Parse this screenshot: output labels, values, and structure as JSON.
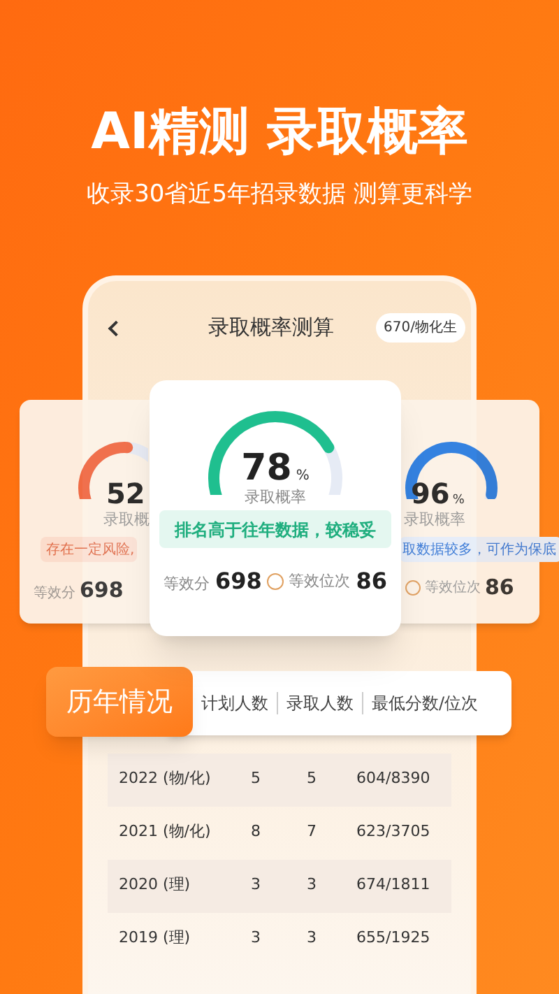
{
  "headline": "AI精测 录取概率",
  "subtitle": "收录30省近5年招录数据 测算更科学",
  "nav": {
    "title": "录取概率测算",
    "badge": "670/物化生"
  },
  "cards": [
    {
      "kind": "left",
      "percent": "52",
      "label": "录取概",
      "color": "#f06a45",
      "note": "存在一定风险,",
      "stat1_label": "等效分",
      "stat1_value": "698"
    },
    {
      "kind": "center",
      "percent": "78",
      "unit": "%",
      "label": "录取概率",
      "color": "#1fbf8f",
      "note": "排名高于往年数据，较稳妥",
      "stat1_label": "等效分",
      "stat1_value": "698",
      "stat2_label": "等效位次",
      "stat2_value": "86"
    },
    {
      "kind": "right",
      "percent": "96",
      "unit": "%",
      "label": "录取概率",
      "color": "#2a7de1",
      "note": "取数据较多，可作为保底",
      "stat2_label": "等效位次",
      "stat2_value": "86"
    }
  ],
  "history": {
    "columns": [
      "历年情况",
      "计划人数",
      "录取人数",
      "最低分数/位次"
    ],
    "rows": [
      [
        "2022 (物/化)",
        "5",
        "5",
        "604/8390"
      ],
      [
        "2021 (物/化)",
        "8",
        "7",
        "623/3705"
      ],
      [
        "2020 (理)",
        "3",
        "3",
        "674/1811"
      ],
      [
        "2019 (理)",
        "3",
        "3",
        "655/1925"
      ]
    ]
  }
}
